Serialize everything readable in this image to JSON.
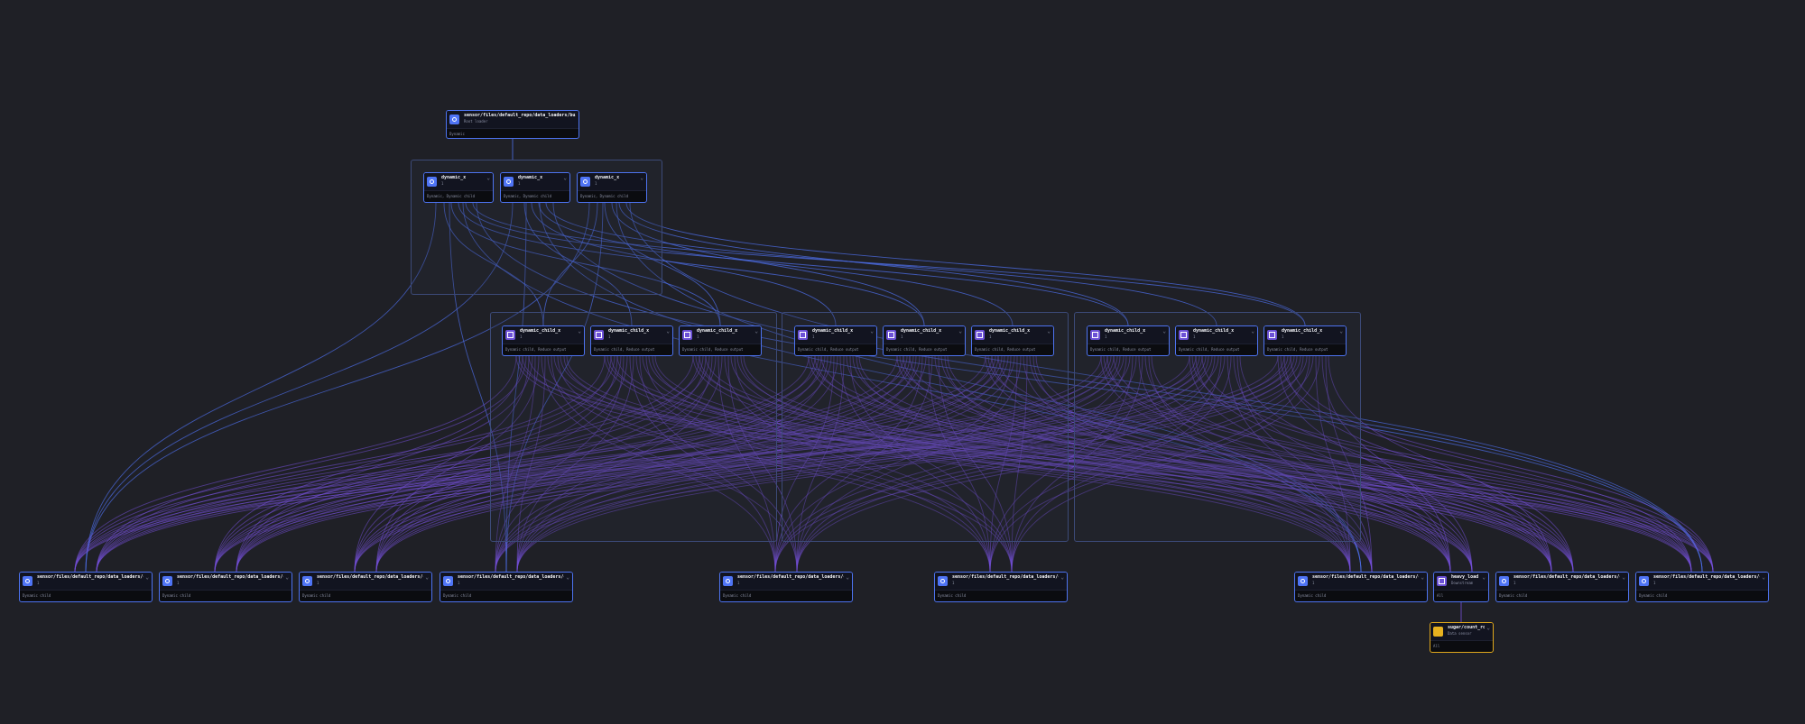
{
  "ops": {
    "root": {
      "name": "sensor/files/default_repo/data_loaders/build_stream",
      "sub": "Root loader",
      "desc": "Dynamic"
    },
    "dyn_1": {
      "name": "dynamic_x",
      "count": "1",
      "desc": "Dynamic, Dynamic child"
    },
    "dyn_2": {
      "name": "dynamic_x",
      "count": "1",
      "desc": "Dynamic, Dynamic child"
    },
    "dyn_3": {
      "name": "dynamic_x",
      "count": "1",
      "desc": "Dynamic, Dynamic child"
    },
    "child_1": {
      "name": "dynamic_child_x",
      "count": "1",
      "desc": "Dynamic child, Reduce output"
    },
    "child_2": {
      "name": "dynamic_child_x",
      "count": "1",
      "desc": "Dynamic child, Reduce output"
    },
    "child_3": {
      "name": "dynamic_child_x",
      "count": "1",
      "desc": "Dynamic child, Reduce output"
    },
    "child_4": {
      "name": "dynamic_child_x",
      "count": "1",
      "desc": "Dynamic child, Reduce output"
    },
    "child_5": {
      "name": "dynamic_child_x",
      "count": "1",
      "desc": "Dynamic child, Reduce output"
    },
    "child_6": {
      "name": "dynamic_child_x",
      "count": "1",
      "desc": "Dynamic child, Reduce output"
    },
    "child_7": {
      "name": "dynamic_child_x",
      "count": "1",
      "desc": "Dynamic child, Reduce output"
    },
    "child_8": {
      "name": "dynamic_child_x",
      "count": "1",
      "desc": "Dynamic child, Reduce output"
    },
    "child_9": {
      "name": "dynamic_child_x",
      "count": "1",
      "desc": "Dynamic child, Reduce output"
    },
    "out_1": {
      "name": "sensor/files/default_repo/data_loaders/custom_xxx",
      "count": "1",
      "desc": "Dynamic child"
    },
    "out_2": {
      "name": "sensor/files/default_repo/data_loaders/custom_xxx",
      "count": "1",
      "desc": "Dynamic child"
    },
    "out_3": {
      "name": "sensor/files/default_repo/data_loaders/custom_xxx",
      "count": "1",
      "desc": "Dynamic child"
    },
    "out_4": {
      "name": "sensor/files/default_repo/data_loaders/custom_xxx",
      "count": "1",
      "desc": "Dynamic child"
    },
    "out_5": {
      "name": "sensor/files/default_repo/data_loaders/custom_xxx",
      "count": "1",
      "desc": "Dynamic child"
    },
    "out_6": {
      "name": "sensor/files/default_repo/data_loaders/custom_xxx",
      "count": "1",
      "desc": "Dynamic child"
    },
    "out_7": {
      "name": "sensor/files/default_repo/data_loaders/custom_xxx",
      "count": "1",
      "desc": "Dynamic child"
    },
    "heavy": {
      "name": "heavy_load",
      "sub": "Downstream",
      "desc": "All"
    },
    "out_8": {
      "name": "sensor/files/default_repo/data_loaders/custom_xxx",
      "count": "1",
      "desc": "Dynamic child"
    },
    "out_9": {
      "name": "sensor/files/default_repo/data_loaders/custom_xxx",
      "count": "1",
      "desc": "Dynamic child"
    },
    "sensor": {
      "name": "sugar/count_rows",
      "sub": "Data sensor",
      "desc": "All"
    }
  },
  "icons": {
    "op": "circle-op-icon",
    "graph": "square-graph-icon",
    "sensor": "sensor-icon",
    "expand": "chevron-down-icon"
  },
  "colors": {
    "background": "#1f2026",
    "node_border": "#4d73f0",
    "sensor_border": "#e0a81c",
    "edge_blue": "#4d6ee8",
    "edge_purple": "#7550d8"
  }
}
